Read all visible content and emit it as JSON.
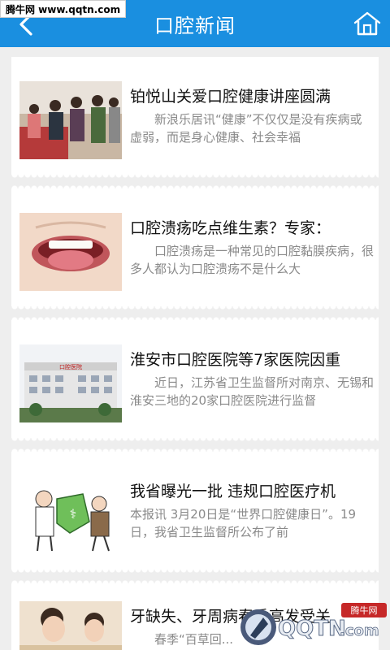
{
  "watermark": "腾牛网 www.qqtn.com",
  "header": {
    "title": "口腔新闻"
  },
  "news": [
    {
      "title": "铂悦山关爱口腔健康讲座圆满",
      "summary": "　　新浪乐居讯“健康”不仅仅是没有疾病或虚弱，而是身心健康、社会幸福"
    },
    {
      "title": "口腔溃疡吃点维生素？专家：",
      "summary": "　　口腔溃疡是一种常见的口腔黏膜疾病，很多人都认为口腔溃疡不是什么大"
    },
    {
      "title": "淮安市口腔医院等7家医院因重",
      "summary": "　　近日，江苏省卫生监督所对南京、无锡和淮安三地的20家口腔医院进行监督"
    },
    {
      "title": "我省曝光一批 违规口腔医疗机",
      "summary": "本报讯 3月20日是“世界口腔健康日”。19日，我省卫生监督所公布了前"
    },
    {
      "title": "牙缺失、牙周病春季高发受关",
      "summary": "　　春季“百草回..."
    }
  ],
  "hospital_sign": "口腔医院",
  "badge": {
    "brand": "QQTN",
    "suffix": ".com",
    "tag": "腾牛网"
  },
  "colors": {
    "header": "#1a8fe0",
    "background": "#eeeeee",
    "summary": "#8a8a8a"
  }
}
